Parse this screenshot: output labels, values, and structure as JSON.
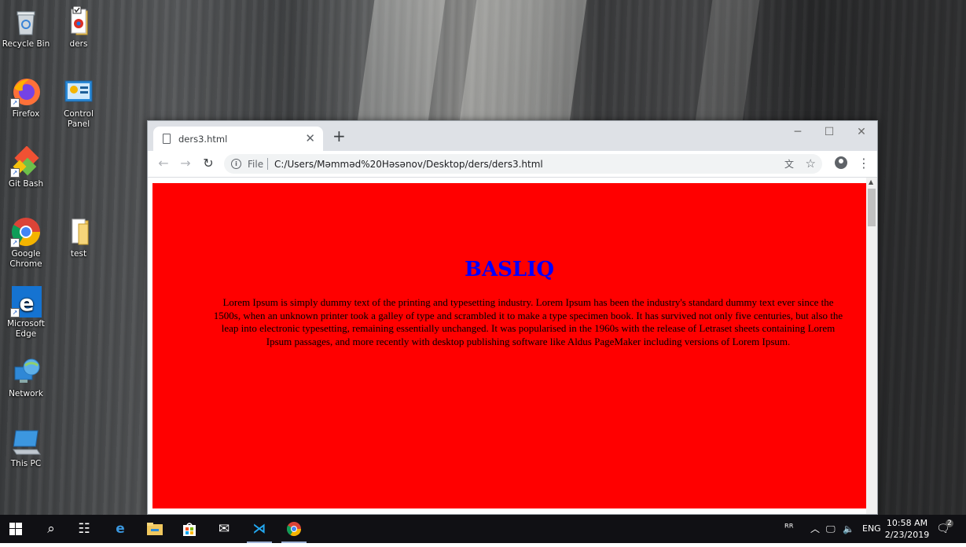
{
  "desktop": {
    "icons": [
      {
        "label": "Recycle Bin"
      },
      {
        "label": "ders"
      },
      {
        "label": "Firefox"
      },
      {
        "label": "Control Panel"
      },
      {
        "label": "Git Bash"
      },
      {
        "label": "Google Chrome"
      },
      {
        "label": "test"
      },
      {
        "label": "Microsoft Edge"
      },
      {
        "label": "Network"
      },
      {
        "label": "This PC"
      }
    ]
  },
  "browser": {
    "tab_title": "ders3.html",
    "new_tab_symbol": "+",
    "close_symbol": "✕",
    "omnibox": {
      "scheme": "File",
      "url": "C:/Users/Məmməd%20Həsənov/Desktop/ders/ders3.html"
    }
  },
  "page": {
    "background": "#ff0000",
    "heading": "BASLIQ",
    "heading_color": "#0000ff",
    "paragraph": "Lorem Ipsum is simply dummy text of the printing and typesetting industry. Lorem Ipsum has been the industry's standard dummy text ever since the 1500s, when an unknown printer took a galley of type and scrambled it to make a type specimen book. It has survived not only five centuries, but also the leap into electronic typesetting, remaining essentially unchanged. It was popularised in the 1960s with the release of Letraset sheets containing Lorem Ipsum passages, and more recently with desktop publishing software like Aldus PageMaker including versions of Lorem Ipsum."
  },
  "taskbar": {
    "language": "ENG",
    "time": "10:58 AM",
    "date": "2/23/2019",
    "notification_count": "2"
  }
}
